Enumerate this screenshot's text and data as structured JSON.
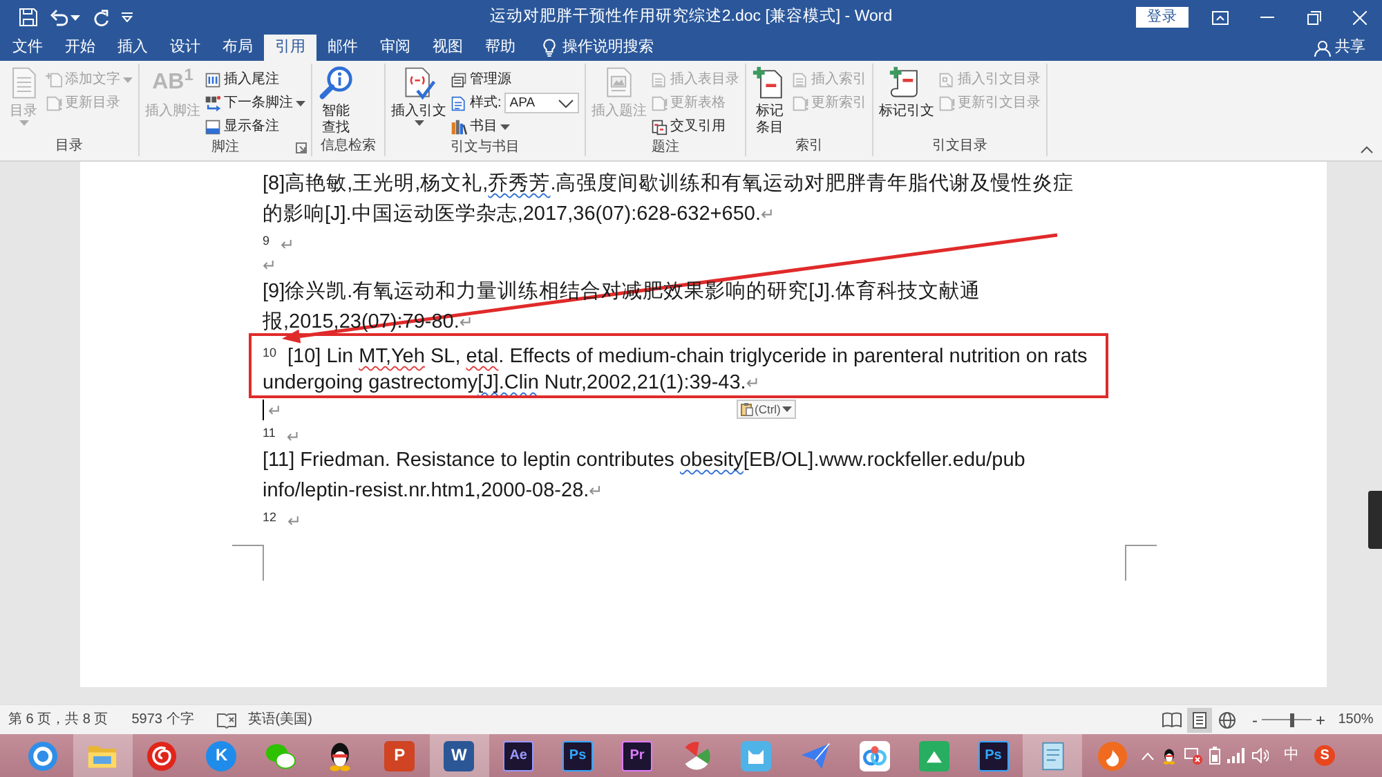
{
  "window": {
    "title": "运动对肥胖干预性作用研究综述2.doc [兼容模式] - Word",
    "sign_in": "登录"
  },
  "tabs": [
    {
      "label": "文件",
      "selected": false
    },
    {
      "label": "开始",
      "selected": false
    },
    {
      "label": "插入",
      "selected": false
    },
    {
      "label": "设计",
      "selected": false
    },
    {
      "label": "布局",
      "selected": false
    },
    {
      "label": "引用",
      "selected": true
    },
    {
      "label": "邮件",
      "selected": false
    },
    {
      "label": "审阅",
      "selected": false
    },
    {
      "label": "视图",
      "selected": false
    },
    {
      "label": "帮助",
      "selected": false
    }
  ],
  "tell_me": {
    "placeholder": "操作说明搜索"
  },
  "share": "共享",
  "ribbon": [
    {
      "label": "目录",
      "launcher": false,
      "items": [
        {
          "kind": "large",
          "label": "目录",
          "disabled": true,
          "dropdown": true
        },
        {
          "kind": "small",
          "label": "添加文字",
          "disabled": true,
          "dropdown": true
        },
        {
          "kind": "small",
          "label": "更新目录",
          "disabled": true,
          "dropdown": false
        }
      ]
    },
    {
      "label": "脚注",
      "launcher": true,
      "items": [
        {
          "kind": "large",
          "label": "插入脚注",
          "icon_text": "AB$^{1}$",
          "disabled": true,
          "dropdown": false
        },
        {
          "kind": "small",
          "label": "插入尾注",
          "disabled": false,
          "dropdown": false
        },
        {
          "kind": "small",
          "label": "下一条脚注",
          "disabled": false,
          "dropdown": true
        },
        {
          "kind": "small",
          "label": "显示备注",
          "disabled": false,
          "dropdown": false
        }
      ]
    },
    {
      "label": "信息检索",
      "launcher": false,
      "items": [
        {
          "kind": "large",
          "label_lines": [
            "智能",
            "查找"
          ],
          "disabled": false,
          "dropdown": false
        }
      ]
    },
    {
      "label": "引文与书目",
      "launcher": false,
      "items": [
        {
          "kind": "large",
          "label": "插入引文",
          "disabled": false,
          "dropdown": true
        },
        {
          "kind": "small",
          "label": "管理源",
          "disabled": false,
          "dropdown": false
        },
        {
          "kind": "select",
          "label": "样式:",
          "value": "APA"
        },
        {
          "kind": "small",
          "label": "书目",
          "disabled": false,
          "dropdown": true
        }
      ]
    },
    {
      "label": "题注",
      "launcher": false,
      "items": [
        {
          "kind": "large",
          "label": "插入题注",
          "disabled": true,
          "dropdown": false
        },
        {
          "kind": "small",
          "label": "插入表目录",
          "disabled": true,
          "dropdown": false
        },
        {
          "kind": "small",
          "label": "更新表格",
          "disabled": true,
          "dropdown": false
        },
        {
          "kind": "small",
          "label": "交叉引用",
          "disabled": false,
          "dropdown": false
        }
      ]
    },
    {
      "label": "索引",
      "launcher": false,
      "items": [
        {
          "kind": "large",
          "label_lines": [
            "标记",
            "条目"
          ],
          "disabled": false,
          "dropdown": false
        },
        {
          "kind": "small",
          "label": "插入索引",
          "disabled": true,
          "dropdown": false
        },
        {
          "kind": "small",
          "label": "更新索引",
          "disabled": true,
          "dropdown": false
        }
      ]
    },
    {
      "label": "引文目录",
      "launcher": false,
      "items": [
        {
          "kind": "large",
          "label": "标记引文",
          "disabled": false,
          "dropdown": false
        },
        {
          "kind": "small",
          "label": "插入引文目录",
          "disabled": true,
          "dropdown": false
        },
        {
          "kind": "small",
          "label": "更新引文目录",
          "disabled": true,
          "dropdown": false
        }
      ]
    }
  ],
  "document": {
    "paragraphs": [
      {
        "kind": "reference",
        "cursor": false,
        "lines": [
          [
            {
              "kind": "plain",
              "text": "[8]高艳敏,王光明,杨文礼,"
            },
            {
              "kind": "grammar",
              "text": "乔秀芳"
            },
            {
              "kind": "plain",
              "text": ".高强度间歇训练和有氧运动对肥胖青年脂代谢及慢性炎症"
            }
          ],
          [
            {
              "kind": "plain",
              "text": "的影响[J].中国运动医学杂志,2017,36(07):628-632+650."
            }
          ]
        ],
        "mark": "↵"
      },
      {
        "kind": "blank",
        "number": "9",
        "cursor": false,
        "mark": "↵"
      },
      {
        "kind": "blank",
        "cursor": false,
        "mark": "↵"
      },
      {
        "kind": "reference",
        "cursor": false,
        "lines": [
          [
            {
              "kind": "plain",
              "text": "[9]徐兴凯.有氧运动和力量训练相结合对减肥效果影响的研究[J].体育科技文献通"
            }
          ],
          [
            {
              "kind": "plain",
              "text": "报,2015,23(07):79-80."
            }
          ]
        ],
        "mark": "↵"
      },
      {
        "kind": "reference",
        "number": "10",
        "cursor": false,
        "lines": [
          [
            {
              "kind": "plain",
              "text": "[10] Lin "
            },
            {
              "kind": "spelling",
              "text": "MT,Yeh"
            },
            {
              "kind": "plain",
              "text": " SL, "
            },
            {
              "kind": "spelling",
              "text": "etal"
            },
            {
              "kind": "plain",
              "text": ". Effects of medium-chain triglyceride in parenteral nutrition on rats"
            }
          ],
          [
            {
              "kind": "plain",
              "text": "undergoing gastrectomy"
            },
            {
              "kind": "grammar",
              "text": "[J].Clin"
            },
            {
              "kind": "plain",
              "text": " Nutr,2002,21(1):39-43."
            }
          ]
        ],
        "mark": "↵"
      },
      {
        "kind": "blank",
        "cursor": true,
        "mark": "↵",
        "paste_options": "(Ctrl)"
      },
      {
        "kind": "blank",
        "number": "11",
        "cursor": false,
        "mark": "↵"
      },
      {
        "kind": "reference",
        "cursor": false,
        "lines": [
          [
            {
              "kind": "plain",
              "text": "[11] Friedman. Resistance to leptin contributes "
            },
            {
              "kind": "grammar",
              "text": "obesity"
            },
            {
              "kind": "plain",
              "text": "[EB/OL].www.rockfeller.edu/pub"
            }
          ],
          [
            {
              "kind": "plain",
              "text": "info/leptin-resist.nr.htm1,2000-08-28."
            }
          ]
        ],
        "mark": "↵"
      },
      {
        "kind": "blank",
        "number": "12",
        "cursor": false,
        "mark": "↵"
      }
    ]
  },
  "annotations": {
    "highlight_box": true,
    "arrow": true
  },
  "status_bar": {
    "page": "第 6 页，共 8 页",
    "words": "5973 个字",
    "language": "英语(美国)",
    "views": [
      {
        "selected": false
      },
      {
        "selected": true
      },
      {
        "selected": false
      }
    ],
    "zoom": {
      "minus": "-",
      "plus": "+",
      "level": 0.6,
      "reading": "150%"
    }
  },
  "taskbar": {
    "apps": [
      {
        "kind": "ring",
        "running": false
      },
      {
        "kind": "folder",
        "running": true
      },
      {
        "kind": "swirl",
        "running": false
      },
      {
        "kind": "letter-disc",
        "label": "K",
        "color": "#1f8ceb",
        "running": false
      },
      {
        "kind": "chat",
        "running": false
      },
      {
        "kind": "penguin",
        "running": false
      },
      {
        "kind": "office-tile",
        "label": "P",
        "color": "#d04423",
        "running": false
      },
      {
        "kind": "office-tile",
        "label": "W",
        "color": "#2b5797",
        "running": true
      },
      {
        "kind": "adobe-tile",
        "label": "Ae",
        "color": "#9a99ff",
        "running": false
      },
      {
        "kind": "adobe-tile",
        "label": "Ps",
        "color": "#31a8ff",
        "running": false
      },
      {
        "kind": "adobe-tile",
        "label": "Pr",
        "color": "#e07bff",
        "running": false
      },
      {
        "kind": "fan",
        "running": false
      },
      {
        "kind": "cat",
        "running": false
      },
      {
        "kind": "plane",
        "running": false
      },
      {
        "kind": "rings",
        "running": false
      },
      {
        "kind": "triangle-tile",
        "running": false
      },
      {
        "kind": "adobe-tile",
        "label": "Ps",
        "color": "#31a8ff",
        "running": false
      },
      {
        "kind": "notebook",
        "running": true
      },
      {
        "kind": "flame-disc",
        "running": false
      }
    ],
    "tray": [
      {
        "kind": "chevron"
      },
      {
        "kind": "penguin"
      },
      {
        "kind": "network-alert"
      },
      {
        "kind": "battery"
      },
      {
        "kind": "signal"
      },
      {
        "kind": "volume"
      },
      {
        "kind": "text",
        "label": "中"
      },
      {
        "kind": "letter-disc",
        "label": "S",
        "color": "#e8461e"
      }
    ]
  }
}
